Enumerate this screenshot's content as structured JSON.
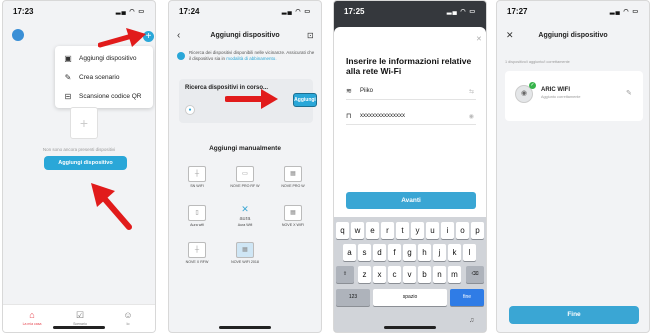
{
  "phone1": {
    "time": "17:23",
    "menu": [
      {
        "icon": "add-device-icon",
        "label": "Aggiungi dispositivo"
      },
      {
        "icon": "create-scene-icon",
        "label": "Crea scenario"
      },
      {
        "icon": "qr-scan-icon",
        "label": "Scansione codice QR"
      }
    ],
    "empty_text": "Non sono ancora presenti dispositivi",
    "add_button": "Aggiungi dispositivo",
    "tabs": [
      {
        "icon": "home-icon",
        "label": "La mia casa"
      },
      {
        "icon": "scene-icon",
        "label": "Scenario"
      },
      {
        "icon": "profile-icon",
        "label": "Io"
      }
    ]
  },
  "phone2": {
    "time": "17:24",
    "title": "Aggiungi dispositivo",
    "info_text": "Ricerca dei dispositivi disponibili nelle vicinanze. Assicurati che il dispositivo sia in",
    "info_link": "modalità di abbinamento.",
    "searching": "Ricerca dispositivi in corso...",
    "add_small": "Aggiungi",
    "manual_title": "Aggiungi manualmente",
    "devices": [
      "SN WIFI",
      "NOVE PRO RF W",
      "NOVE PRO W",
      "Aura wifi",
      "Aura Wifi",
      "NOVE X WIFI",
      "NOVE X RFW",
      "NOVE WIFI 2018"
    ],
    "aura_logo": "aura"
  },
  "phone3": {
    "time": "17:25",
    "heading": "Inserire le informazioni relative alla rete Wi-Fi",
    "ssid": "Piiko",
    "password": "xxxxxxxxxxxxxxx",
    "next_button": "Avanti",
    "keyboard": {
      "row1": [
        "q",
        "w",
        "e",
        "r",
        "t",
        "y",
        "u",
        "i",
        "o",
        "p"
      ],
      "row2": [
        "a",
        "s",
        "d",
        "f",
        "g",
        "h",
        "j",
        "k",
        "l"
      ],
      "row3": [
        "z",
        "x",
        "c",
        "v",
        "b",
        "n",
        "m"
      ],
      "numbers_key": "123",
      "space_key": "spazio",
      "done_key": "fine"
    }
  },
  "phone4": {
    "time": "17:27",
    "title": "Aggiungi dispositivo",
    "subtitle": "1 dispositivo/i aggiunto/i correttamente",
    "device_name": "ARIC WIFI",
    "device_status": "Aggiunto correttamente",
    "done_button": "Fine"
  },
  "colors": {
    "accent": "#2aa7d8",
    "arrow": "#e11b1b",
    "active_tab": "#e6424c"
  }
}
